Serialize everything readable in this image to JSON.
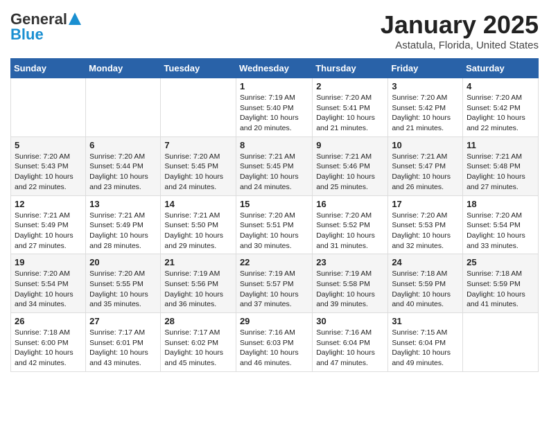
{
  "logo": {
    "general": "General",
    "blue": "Blue"
  },
  "title": "January 2025",
  "subtitle": "Astatula, Florida, United States",
  "headers": [
    "Sunday",
    "Monday",
    "Tuesday",
    "Wednesday",
    "Thursday",
    "Friday",
    "Saturday"
  ],
  "weeks": [
    [
      {
        "day": "",
        "info": ""
      },
      {
        "day": "",
        "info": ""
      },
      {
        "day": "",
        "info": ""
      },
      {
        "day": "1",
        "info": "Sunrise: 7:19 AM\nSunset: 5:40 PM\nDaylight: 10 hours\nand 20 minutes."
      },
      {
        "day": "2",
        "info": "Sunrise: 7:20 AM\nSunset: 5:41 PM\nDaylight: 10 hours\nand 21 minutes."
      },
      {
        "day": "3",
        "info": "Sunrise: 7:20 AM\nSunset: 5:42 PM\nDaylight: 10 hours\nand 21 minutes."
      },
      {
        "day": "4",
        "info": "Sunrise: 7:20 AM\nSunset: 5:42 PM\nDaylight: 10 hours\nand 22 minutes."
      }
    ],
    [
      {
        "day": "5",
        "info": "Sunrise: 7:20 AM\nSunset: 5:43 PM\nDaylight: 10 hours\nand 22 minutes."
      },
      {
        "day": "6",
        "info": "Sunrise: 7:20 AM\nSunset: 5:44 PM\nDaylight: 10 hours\nand 23 minutes."
      },
      {
        "day": "7",
        "info": "Sunrise: 7:20 AM\nSunset: 5:45 PM\nDaylight: 10 hours\nand 24 minutes."
      },
      {
        "day": "8",
        "info": "Sunrise: 7:21 AM\nSunset: 5:45 PM\nDaylight: 10 hours\nand 24 minutes."
      },
      {
        "day": "9",
        "info": "Sunrise: 7:21 AM\nSunset: 5:46 PM\nDaylight: 10 hours\nand 25 minutes."
      },
      {
        "day": "10",
        "info": "Sunrise: 7:21 AM\nSunset: 5:47 PM\nDaylight: 10 hours\nand 26 minutes."
      },
      {
        "day": "11",
        "info": "Sunrise: 7:21 AM\nSunset: 5:48 PM\nDaylight: 10 hours\nand 27 minutes."
      }
    ],
    [
      {
        "day": "12",
        "info": "Sunrise: 7:21 AM\nSunset: 5:49 PM\nDaylight: 10 hours\nand 27 minutes."
      },
      {
        "day": "13",
        "info": "Sunrise: 7:21 AM\nSunset: 5:49 PM\nDaylight: 10 hours\nand 28 minutes."
      },
      {
        "day": "14",
        "info": "Sunrise: 7:21 AM\nSunset: 5:50 PM\nDaylight: 10 hours\nand 29 minutes."
      },
      {
        "day": "15",
        "info": "Sunrise: 7:20 AM\nSunset: 5:51 PM\nDaylight: 10 hours\nand 30 minutes."
      },
      {
        "day": "16",
        "info": "Sunrise: 7:20 AM\nSunset: 5:52 PM\nDaylight: 10 hours\nand 31 minutes."
      },
      {
        "day": "17",
        "info": "Sunrise: 7:20 AM\nSunset: 5:53 PM\nDaylight: 10 hours\nand 32 minutes."
      },
      {
        "day": "18",
        "info": "Sunrise: 7:20 AM\nSunset: 5:54 PM\nDaylight: 10 hours\nand 33 minutes."
      }
    ],
    [
      {
        "day": "19",
        "info": "Sunrise: 7:20 AM\nSunset: 5:54 PM\nDaylight: 10 hours\nand 34 minutes."
      },
      {
        "day": "20",
        "info": "Sunrise: 7:20 AM\nSunset: 5:55 PM\nDaylight: 10 hours\nand 35 minutes."
      },
      {
        "day": "21",
        "info": "Sunrise: 7:19 AM\nSunset: 5:56 PM\nDaylight: 10 hours\nand 36 minutes."
      },
      {
        "day": "22",
        "info": "Sunrise: 7:19 AM\nSunset: 5:57 PM\nDaylight: 10 hours\nand 37 minutes."
      },
      {
        "day": "23",
        "info": "Sunrise: 7:19 AM\nSunset: 5:58 PM\nDaylight: 10 hours\nand 39 minutes."
      },
      {
        "day": "24",
        "info": "Sunrise: 7:18 AM\nSunset: 5:59 PM\nDaylight: 10 hours\nand 40 minutes."
      },
      {
        "day": "25",
        "info": "Sunrise: 7:18 AM\nSunset: 5:59 PM\nDaylight: 10 hours\nand 41 minutes."
      }
    ],
    [
      {
        "day": "26",
        "info": "Sunrise: 7:18 AM\nSunset: 6:00 PM\nDaylight: 10 hours\nand 42 minutes."
      },
      {
        "day": "27",
        "info": "Sunrise: 7:17 AM\nSunset: 6:01 PM\nDaylight: 10 hours\nand 43 minutes."
      },
      {
        "day": "28",
        "info": "Sunrise: 7:17 AM\nSunset: 6:02 PM\nDaylight: 10 hours\nand 45 minutes."
      },
      {
        "day": "29",
        "info": "Sunrise: 7:16 AM\nSunset: 6:03 PM\nDaylight: 10 hours\nand 46 minutes."
      },
      {
        "day": "30",
        "info": "Sunrise: 7:16 AM\nSunset: 6:04 PM\nDaylight: 10 hours\nand 47 minutes."
      },
      {
        "day": "31",
        "info": "Sunrise: 7:15 AM\nSunset: 6:04 PM\nDaylight: 10 hours\nand 49 minutes."
      },
      {
        "day": "",
        "info": ""
      }
    ]
  ]
}
